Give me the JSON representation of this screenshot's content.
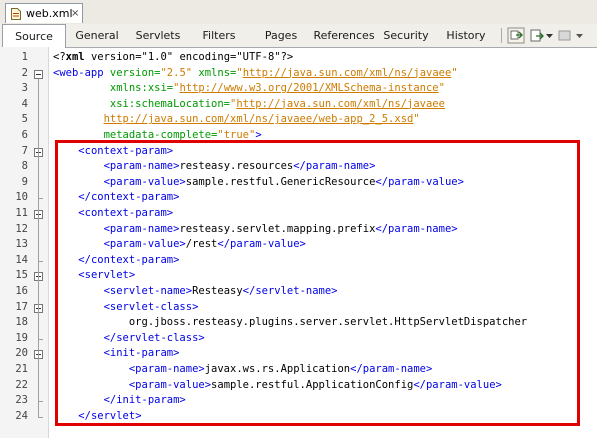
{
  "file_tab": {
    "label": "web.xml",
    "close": "×"
  },
  "view_tabs": [
    "Source",
    "General",
    "Servlets",
    "Filters",
    "Pages",
    "References",
    "Security",
    "History"
  ],
  "toolbar_icons": [
    "back-forward-icon",
    "dropdown-arrow-icon",
    "history-nav-icon",
    "dropdown-arrow-icon",
    "more-icon"
  ],
  "highlight_color": "#e00000",
  "code_lines": [
    {
      "n": "1",
      "tokens": [
        {
          "t": "<?",
          "c": "pi"
        },
        {
          "t": "xml",
          "c": "pib"
        },
        {
          "t": " version=\"1.0\" encoding=\"UTF-8\"?>",
          "c": "pi"
        }
      ]
    },
    {
      "n": "2",
      "tokens": [
        {
          "t": "<web-app",
          "c": "tag"
        },
        {
          "t": " version=",
          "c": "attr"
        },
        {
          "t": "\"2.5\"",
          "c": "val"
        },
        {
          "t": " xmlns=",
          "c": "attr"
        },
        {
          "t": "\"",
          "c": "val"
        },
        {
          "t": "http://java.sun.com/xml/ns/javaee",
          "c": "url"
        },
        {
          "t": "\"",
          "c": "val"
        }
      ]
    },
    {
      "n": "3",
      "tokens": [
        {
          "t": "         xmlns:xsi=",
          "c": "attr"
        },
        {
          "t": "\"",
          "c": "val"
        },
        {
          "t": "http://www.w3.org/2001/XMLSchema-instance",
          "c": "url"
        },
        {
          "t": "\"",
          "c": "val"
        }
      ]
    },
    {
      "n": "4",
      "tokens": [
        {
          "t": "         xsi:schemaLocation=",
          "c": "attr"
        },
        {
          "t": "\"",
          "c": "val"
        },
        {
          "t": "http://java.sun.com/xml/ns/javaee",
          "c": "url"
        }
      ]
    },
    {
      "n": "5",
      "tokens": [
        {
          "t": "        ",
          "c": "text"
        },
        {
          "t": "http://java.sun.com/xml/ns/javaee/web-app_2_5.xsd",
          "c": "url"
        },
        {
          "t": "\"",
          "c": "val"
        }
      ]
    },
    {
      "n": "6",
      "tokens": [
        {
          "t": "        metadata-complete=",
          "c": "attr"
        },
        {
          "t": "\"true\"",
          "c": "val"
        },
        {
          "t": ">",
          "c": "tag"
        }
      ]
    },
    {
      "n": "7",
      "tokens": [
        {
          "t": "    ",
          "c": "text"
        },
        {
          "t": "<context-param>",
          "c": "tag"
        }
      ]
    },
    {
      "n": "8",
      "tokens": [
        {
          "t": "        ",
          "c": "text"
        },
        {
          "t": "<param-name>",
          "c": "tag"
        },
        {
          "t": "resteasy.resources",
          "c": "text"
        },
        {
          "t": "</param-name>",
          "c": "tag"
        }
      ]
    },
    {
      "n": "9",
      "tokens": [
        {
          "t": "        ",
          "c": "text"
        },
        {
          "t": "<param-value>",
          "c": "tag"
        },
        {
          "t": "sample.restful.GenericResource",
          "c": "text"
        },
        {
          "t": "</param-value>",
          "c": "tag"
        }
      ]
    },
    {
      "n": "10",
      "tokens": [
        {
          "t": "    ",
          "c": "text"
        },
        {
          "t": "</context-param>",
          "c": "tag"
        }
      ]
    },
    {
      "n": "11",
      "tokens": [
        {
          "t": "    ",
          "c": "text"
        },
        {
          "t": "<context-param>",
          "c": "tag"
        }
      ]
    },
    {
      "n": "12",
      "tokens": [
        {
          "t": "        ",
          "c": "text"
        },
        {
          "t": "<param-name>",
          "c": "tag"
        },
        {
          "t": "resteasy.servlet.mapping.prefix",
          "c": "text"
        },
        {
          "t": "</param-name>",
          "c": "tag"
        }
      ]
    },
    {
      "n": "13",
      "tokens": [
        {
          "t": "        ",
          "c": "text"
        },
        {
          "t": "<param-value>",
          "c": "tag"
        },
        {
          "t": "/rest",
          "c": "text"
        },
        {
          "t": "</param-value>",
          "c": "tag"
        }
      ]
    },
    {
      "n": "14",
      "tokens": [
        {
          "t": "    ",
          "c": "text"
        },
        {
          "t": "</context-param>",
          "c": "tag"
        }
      ]
    },
    {
      "n": "15",
      "tokens": [
        {
          "t": "    ",
          "c": "text"
        },
        {
          "t": "<servlet>",
          "c": "tag"
        }
      ]
    },
    {
      "n": "16",
      "tokens": [
        {
          "t": "        ",
          "c": "text"
        },
        {
          "t": "<servlet-name>",
          "c": "tag"
        },
        {
          "t": "Resteasy",
          "c": "text"
        },
        {
          "t": "</servlet-name>",
          "c": "tag"
        }
      ]
    },
    {
      "n": "17",
      "tokens": [
        {
          "t": "        ",
          "c": "text"
        },
        {
          "t": "<servlet-class>",
          "c": "tag"
        }
      ]
    },
    {
      "n": "18",
      "tokens": [
        {
          "t": "            org.jboss.resteasy.plugins.server.servlet.HttpServletDispatcher",
          "c": "text"
        }
      ]
    },
    {
      "n": "19",
      "tokens": [
        {
          "t": "        ",
          "c": "text"
        },
        {
          "t": "</servlet-class>",
          "c": "tag"
        }
      ]
    },
    {
      "n": "20",
      "tokens": [
        {
          "t": "        ",
          "c": "text"
        },
        {
          "t": "<init-param>",
          "c": "tag"
        }
      ]
    },
    {
      "n": "21",
      "tokens": [
        {
          "t": "            ",
          "c": "text"
        },
        {
          "t": "<param-name>",
          "c": "tag"
        },
        {
          "t": "javax.ws.rs.Application",
          "c": "text"
        },
        {
          "t": "</param-name>",
          "c": "tag"
        }
      ]
    },
    {
      "n": "22",
      "tokens": [
        {
          "t": "            ",
          "c": "text"
        },
        {
          "t": "<param-value>",
          "c": "tag"
        },
        {
          "t": "sample.restful.ApplicationConfig",
          "c": "text"
        },
        {
          "t": "</param-value>",
          "c": "tag"
        }
      ]
    },
    {
      "n": "23",
      "tokens": [
        {
          "t": "        ",
          "c": "text"
        },
        {
          "t": "</init-param>",
          "c": "tag"
        }
      ]
    },
    {
      "n": "24",
      "tokens": [
        {
          "t": "    ",
          "c": "text"
        },
        {
          "t": "</servlet>",
          "c": "tag"
        }
      ]
    }
  ]
}
